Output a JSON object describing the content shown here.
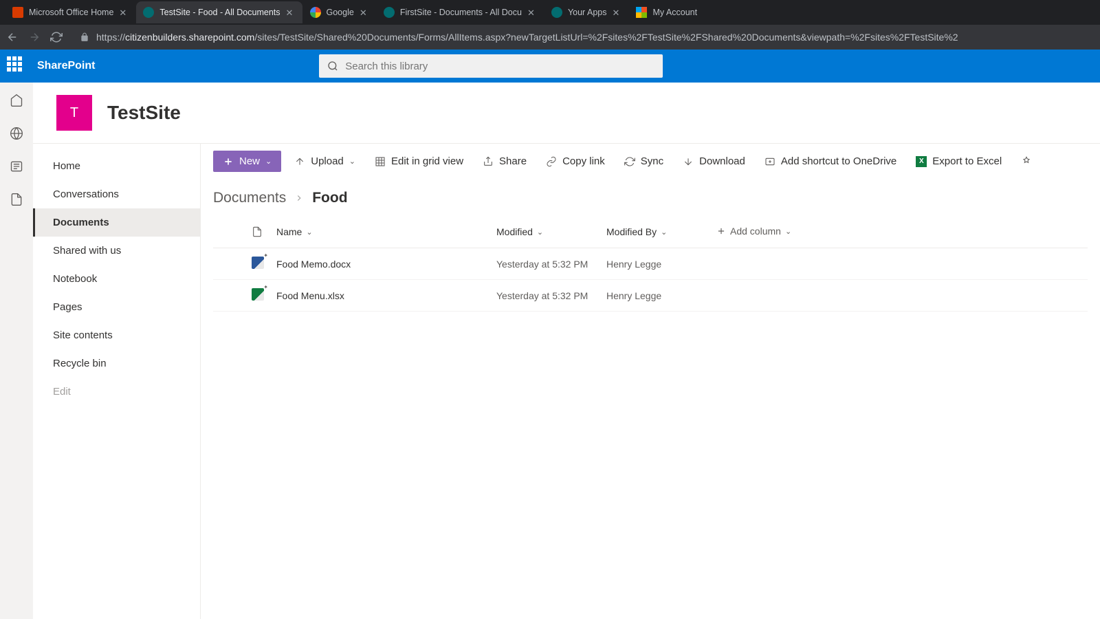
{
  "browser": {
    "tabs": [
      {
        "title": "Microsoft Office Home",
        "active": false,
        "favicon": "office"
      },
      {
        "title": "TestSite - Food - All Documents",
        "active": true,
        "favicon": "sharepoint"
      },
      {
        "title": "Google",
        "active": false,
        "favicon": "google"
      },
      {
        "title": "FirstSite - Documents - All Docu",
        "active": false,
        "favicon": "sharepoint"
      },
      {
        "title": "Your Apps",
        "active": false,
        "favicon": "sharepoint"
      },
      {
        "title": "My Account",
        "active": false,
        "favicon": "microsoft"
      }
    ],
    "url_host": "citizenbuilders.sharepoint.com",
    "url_path": "/sites/TestSite/Shared%20Documents/Forms/AllItems.aspx?newTargetListUrl=%2Fsites%2FTestSite%2FShared%20Documents&viewpath=%2Fsites%2FTestSite%2"
  },
  "suite": {
    "brand": "SharePoint",
    "search_placeholder": "Search this library"
  },
  "site": {
    "logo_letter": "T",
    "title": "TestSite"
  },
  "leftnav": {
    "items": [
      {
        "label": "Home"
      },
      {
        "label": "Conversations"
      },
      {
        "label": "Documents"
      },
      {
        "label": "Shared with us"
      },
      {
        "label": "Notebook"
      },
      {
        "label": "Pages"
      },
      {
        "label": "Site contents"
      },
      {
        "label": "Recycle bin"
      }
    ],
    "edit_label": "Edit",
    "selected_index": 2
  },
  "cmdbar": {
    "new_label": "New",
    "upload_label": "Upload",
    "editgrid_label": "Edit in grid view",
    "share_label": "Share",
    "copylink_label": "Copy link",
    "sync_label": "Sync",
    "download_label": "Download",
    "shortcut_label": "Add shortcut to OneDrive",
    "export_label": "Export to Excel"
  },
  "breadcrumb": {
    "parent": "Documents",
    "current": "Food"
  },
  "columns": {
    "name": "Name",
    "modified": "Modified",
    "modified_by": "Modified By",
    "add": "Add column"
  },
  "files": [
    {
      "name": "Food Memo.docx",
      "type": "word",
      "modified": "Yesterday at 5:32 PM",
      "modified_by": "Henry Legge",
      "is_new": true
    },
    {
      "name": "Food Menu.xlsx",
      "type": "excel",
      "modified": "Yesterday at 5:32 PM",
      "modified_by": "Henry Legge",
      "is_new": true
    }
  ]
}
